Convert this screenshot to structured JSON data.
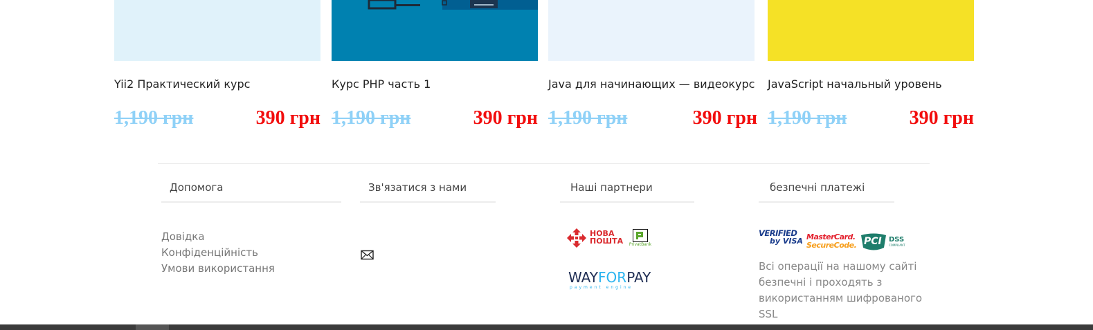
{
  "courses": [
    {
      "title": "Yii2 Практический курс",
      "old_price": "1,190 грн",
      "new_price": "390 грн",
      "thumb_color": "#e0f2fa"
    },
    {
      "title": "Курс PHP часть 1",
      "old_price": "1,190 грн",
      "new_price": "390 грн",
      "thumb_color": "#0081b0"
    },
    {
      "title": "Java для начинающих — видеокурс",
      "old_price": "1,190 грн",
      "new_price": "390 грн",
      "thumb_color": "#eaf3fc"
    },
    {
      "title": "JavaScript начальный уровень",
      "old_price": "1,190 грн",
      "new_price": "390 грн",
      "thumb_color": "#f5e126"
    }
  ],
  "footer": {
    "help": {
      "heading": "Допомога",
      "links": [
        "Довідка",
        "Конфіденційність",
        "Умови використання"
      ]
    },
    "contact": {
      "heading": "Зв'язатися з нами",
      "icon": "envelope-icon"
    },
    "partners": {
      "heading": "Наші партнери",
      "nova_poshta": {
        "line1": "НОВА",
        "line2": "ПОШТА"
      },
      "privatbank": "PrivatBank",
      "wayforpay": {
        "part1": "WAY",
        "part2": "FOR",
        "part3": "PAY",
        "sub": "payment engine"
      }
    },
    "payments": {
      "heading": "безпечні платежі",
      "visa": {
        "line1": "VERIFIED",
        "line2": "by VISA"
      },
      "mastercard": {
        "line1": "MasterCard.",
        "line2": "SecureCode."
      },
      "pci": {
        "mark": "PCI",
        "label": "DSS",
        "sub": "COMPLIANT"
      },
      "note": "Всі операції на нашому сайті безпечні і проходять з використанням шифрованого SSL"
    }
  },
  "colors": {
    "old_price": "#8fd1f7",
    "new_price": "#f20d0d",
    "nova_poshta_red": "#da2b2f",
    "privat_green": "#5aa62c",
    "wayforpay_navy": "#1f2e54",
    "wayforpay_blue": "#2ab4f0",
    "visa_blue": "#1a3c8c",
    "mastercard_red": "#e3212e",
    "mastercard_orange": "#f79e1b",
    "pci_teal": "#1e7d6b"
  }
}
